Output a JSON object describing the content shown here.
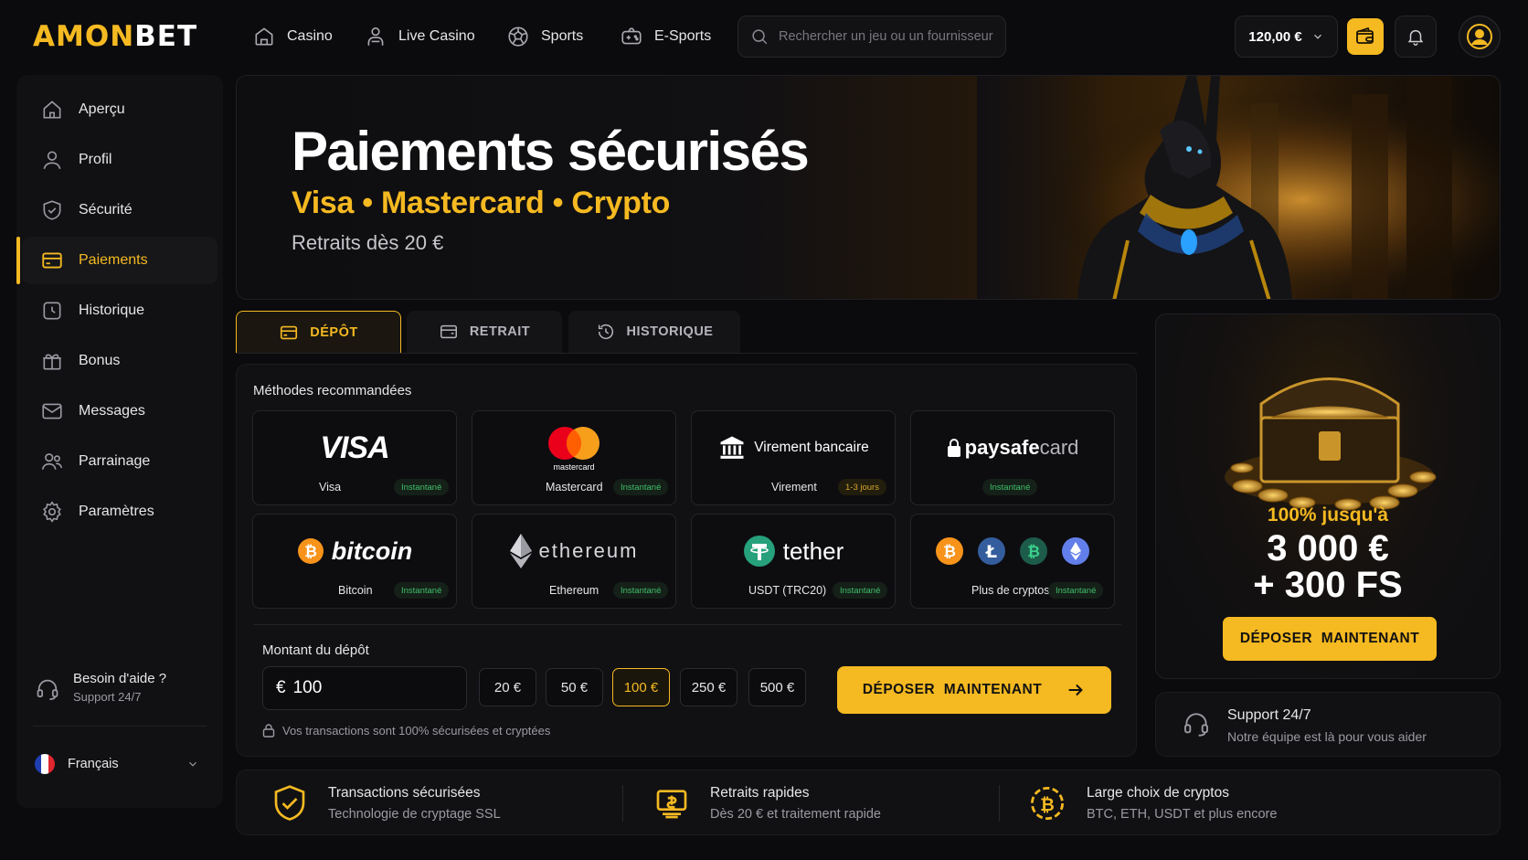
{
  "brand": {
    "part1": "AMON",
    "part2": "BET"
  },
  "nav": [
    {
      "label": "Casino"
    },
    {
      "label": "Live Casino"
    },
    {
      "label": "Sports"
    },
    {
      "label": "E-Sports"
    }
  ],
  "search": {
    "placeholder": "Rechercher un jeu ou un fournisseur"
  },
  "balance": {
    "amount": "120,00 €"
  },
  "sidebar": {
    "items": [
      {
        "label": "Aperçu"
      },
      {
        "label": "Profil"
      },
      {
        "label": "Sécurité"
      },
      {
        "label": "Paiements"
      },
      {
        "label": "Historique"
      },
      {
        "label": "Bonus"
      },
      {
        "label": "Messages"
      },
      {
        "label": "Parrainage"
      },
      {
        "label": "Paramètres"
      }
    ],
    "help_title": "Besoin d'aide ?",
    "help_sub": "Support 24/7",
    "language": "Français"
  },
  "hero": {
    "title": "Paiements sécurisés",
    "methods": "Visa • Mastercard • Crypto",
    "note": "Retraits dès 20 €"
  },
  "tabs": [
    {
      "label": "DÉPÔT"
    },
    {
      "label": "RETRAIT"
    },
    {
      "label": "HISTORIQUE"
    }
  ],
  "methods": {
    "title": "Méthodes recommandées",
    "cards": [
      {
        "logo": "VISA",
        "label": "Visa",
        "badge": "Instantané"
      },
      {
        "logo": "mastercard",
        "label": "Mastercard",
        "badge": "Instantané"
      },
      {
        "logo": "Virement bancaire",
        "label": "Virement",
        "badge": "1-3 jours"
      },
      {
        "logo": "paysafecard",
        "logo_a": "paysafe",
        "logo_b": "card",
        "label": "",
        "badge": "Instantané"
      },
      {
        "logo": "bitcoin",
        "label": "Bitcoin",
        "badge": "Instantané"
      },
      {
        "logo": "ethereum",
        "label": "Ethereum",
        "badge": "Instantané"
      },
      {
        "logo": "tether",
        "label": "USDT (TRC20)",
        "badge": "Instantané"
      },
      {
        "logo": "",
        "label": "Plus de cryptos",
        "badge": "Instantané"
      }
    ]
  },
  "deposit": {
    "label": "Montant du dépôt",
    "currency": "€",
    "value": "100",
    "quick": [
      "20 €",
      "50 €",
      "100 €",
      "250 €",
      "500 €"
    ],
    "selected_quick": "100 €",
    "button": "DÉPOSER  MAINTENANT",
    "note": "Vos transactions sont 100% sécurisées et cryptées"
  },
  "promo": {
    "line1": "100% jusqu'à",
    "line2": "3 000 €",
    "line3": "+ 300 FS",
    "button": "DÉPOSER  MAINTENANT"
  },
  "support": {
    "title": "Support 24/7",
    "sub": "Notre équipe est là pour vous aider"
  },
  "features": [
    {
      "title": "Transactions sécurisées",
      "sub": "Technologie de cryptage SSL"
    },
    {
      "title": "Retraits rapides",
      "sub": "Dès 20 € et traitement rapide"
    },
    {
      "title": "Large choix de cryptos",
      "sub": "BTC, ETH, USDT et plus encore"
    }
  ],
  "colors": {
    "accent": "#f5b921",
    "background": "#0b0b0d",
    "panel": "#111114",
    "success": "#3fbf6a"
  }
}
